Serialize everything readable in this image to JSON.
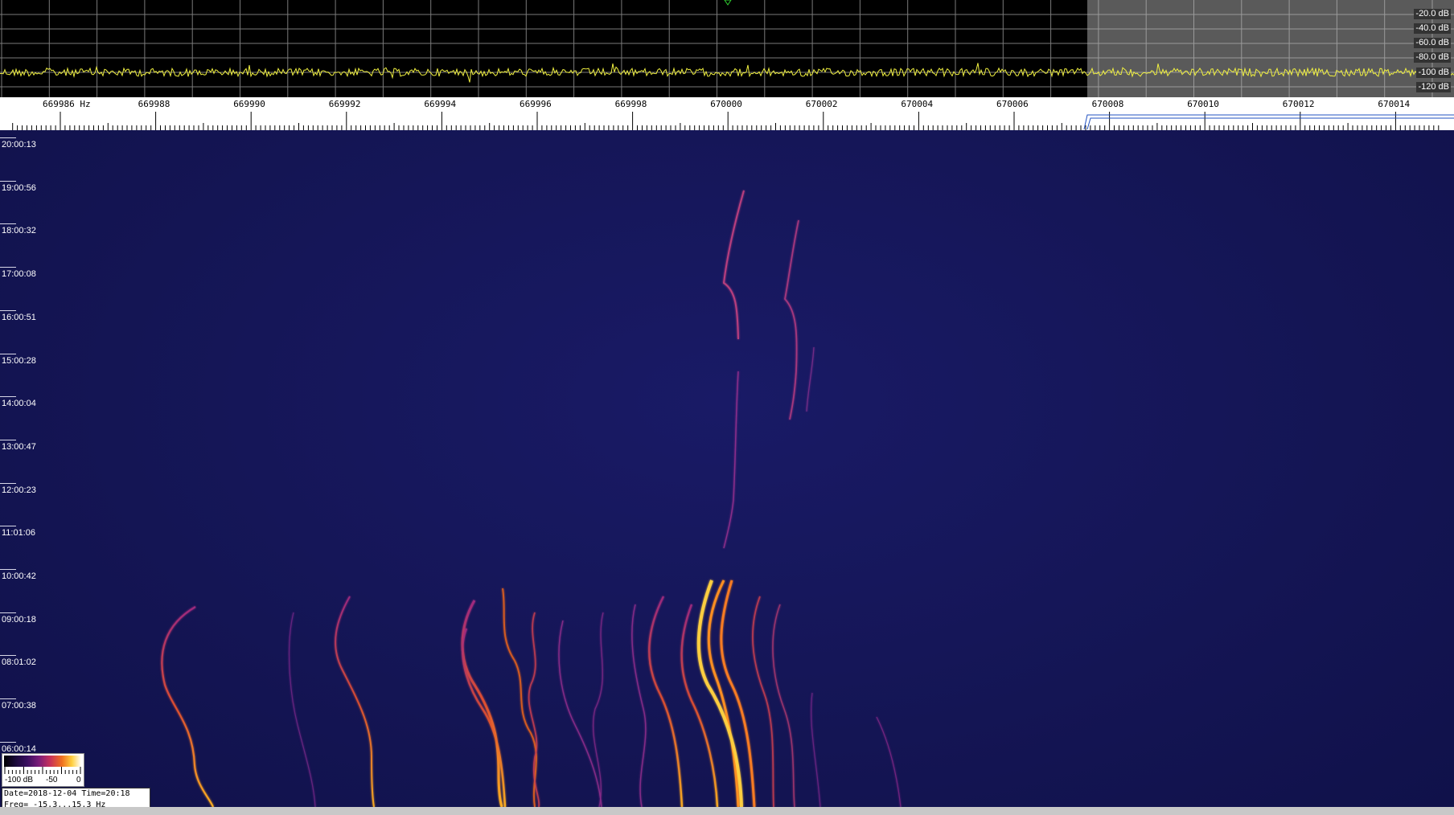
{
  "spectrum": {
    "db_labels": [
      "-20.0 dB",
      "-40.0 dB",
      "-60.0 dB",
      "-80.0 dB",
      "-100 dB",
      "-120 dB"
    ],
    "trace_color": "#f0f040",
    "shade_color": "#6a6a6a"
  },
  "scale": {
    "freq_labels": [
      "669986 Hz",
      "669988",
      "669990",
      "669992",
      "669994",
      "669996",
      "669998",
      "670000",
      "670002",
      "670004",
      "670006",
      "670008",
      "670010",
      "670012",
      "670014"
    ]
  },
  "waterfall": {
    "time_labels": [
      "20:00:13",
      "19:00:56",
      "18:00:32",
      "17:00:08",
      "16:00:51",
      "15:00:28",
      "14:00:04",
      "13:00:47",
      "12:00:23",
      "11:01:06",
      "10:00:42",
      "09:00:18",
      "08:01:02",
      "07:00:38",
      "06:00:14"
    ]
  },
  "colorbar": {
    "labels": [
      "-100 dB",
      "-50",
      "0"
    ]
  },
  "info": {
    "date_time": "Date=2018-12-04 Time=20:18",
    "freq": "Freq= -15.3...15.3 Hz"
  },
  "icons": [
    "marker-triangle-icon"
  ]
}
